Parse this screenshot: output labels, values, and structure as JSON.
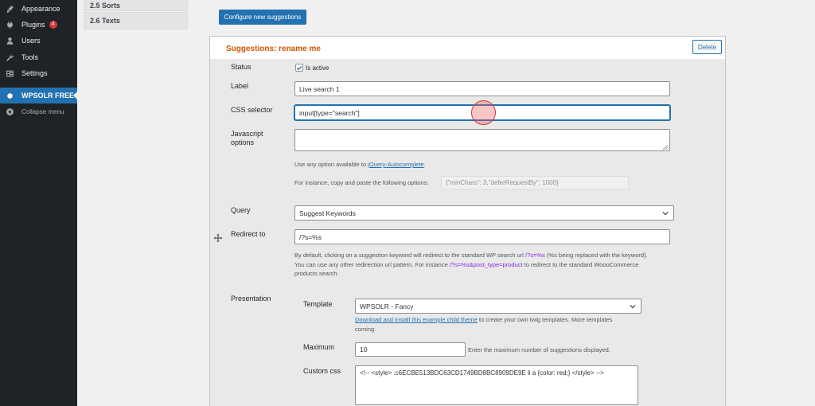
{
  "sidebar": {
    "items": [
      {
        "label": "Appearance",
        "icon": "paintbrush-icon"
      },
      {
        "label": "Plugins",
        "icon": "plugin-icon",
        "badge": "4"
      },
      {
        "label": "Users",
        "icon": "users-icon"
      },
      {
        "label": "Tools",
        "icon": "wrench-icon"
      },
      {
        "label": "Settings",
        "icon": "settings-icon"
      }
    ],
    "current": {
      "label": "WPSOLR FREE",
      "icon": "wpsolr-icon"
    },
    "collapse": {
      "label": "Collapse menu",
      "icon": "collapse-icon"
    }
  },
  "tabs": [
    {
      "label": "2.5 Sorts"
    },
    {
      "label": "2.6 Texts"
    }
  ],
  "configure_button": "Configure new suggestions",
  "panel": {
    "title": "Suggestions: rename me",
    "delete_label": "Delete",
    "status": {
      "label": "Status",
      "checkbox_label": "Is active",
      "checked": true
    },
    "label_field": {
      "label": "Label",
      "value": "Live search 1"
    },
    "css_selector": {
      "label": "CSS selector",
      "value": "input[type=\"search\"]"
    },
    "js_options": {
      "label": "Javascript options",
      "value": "",
      "help_prefix": "Use any option available to ",
      "help_link": "jQuery-Autocomplete",
      "help_suffix": ".",
      "example_label": "For instance, copy and paste the following options:",
      "example_value": "{\"minChars\": 3,\"deferRequestBy\": 1000}"
    },
    "query": {
      "label": "Query",
      "value": "Suggest Keywords"
    },
    "redirect": {
      "label": "Redirect to",
      "value": "/?s=%s",
      "help_1": "By default, clicking on a suggestion keyword will redirect to the standard WP search url ",
      "help_code_1": "/?s=%s",
      "help_2": " (%s being replaced with the keyword).",
      "help_3": "You can use any other redirection url pattern. For instance ",
      "help_code_2": "/?s=%s&post_type=product",
      "help_4": " to redirect to the standard WoooCommerce",
      "help_5": "products search."
    },
    "presentation": {
      "label": "Presentation",
      "template": {
        "label": "Template",
        "value": "WPSOLR - Fancy",
        "help_link": "Download and install this example child theme",
        "help_1": " to create your own twig templates. More templates",
        "help_2": "coming."
      },
      "maximum": {
        "label": "Maximum",
        "value": "10",
        "help": "Enter the maximum number of suggestions displayed."
      },
      "custom_css": {
        "label": "Custom css",
        "value": "<!-- <style> .c6ECBE513BDC63CD1749BD8BC8909DE9E li a {color: red;} </style> -->"
      }
    }
  }
}
